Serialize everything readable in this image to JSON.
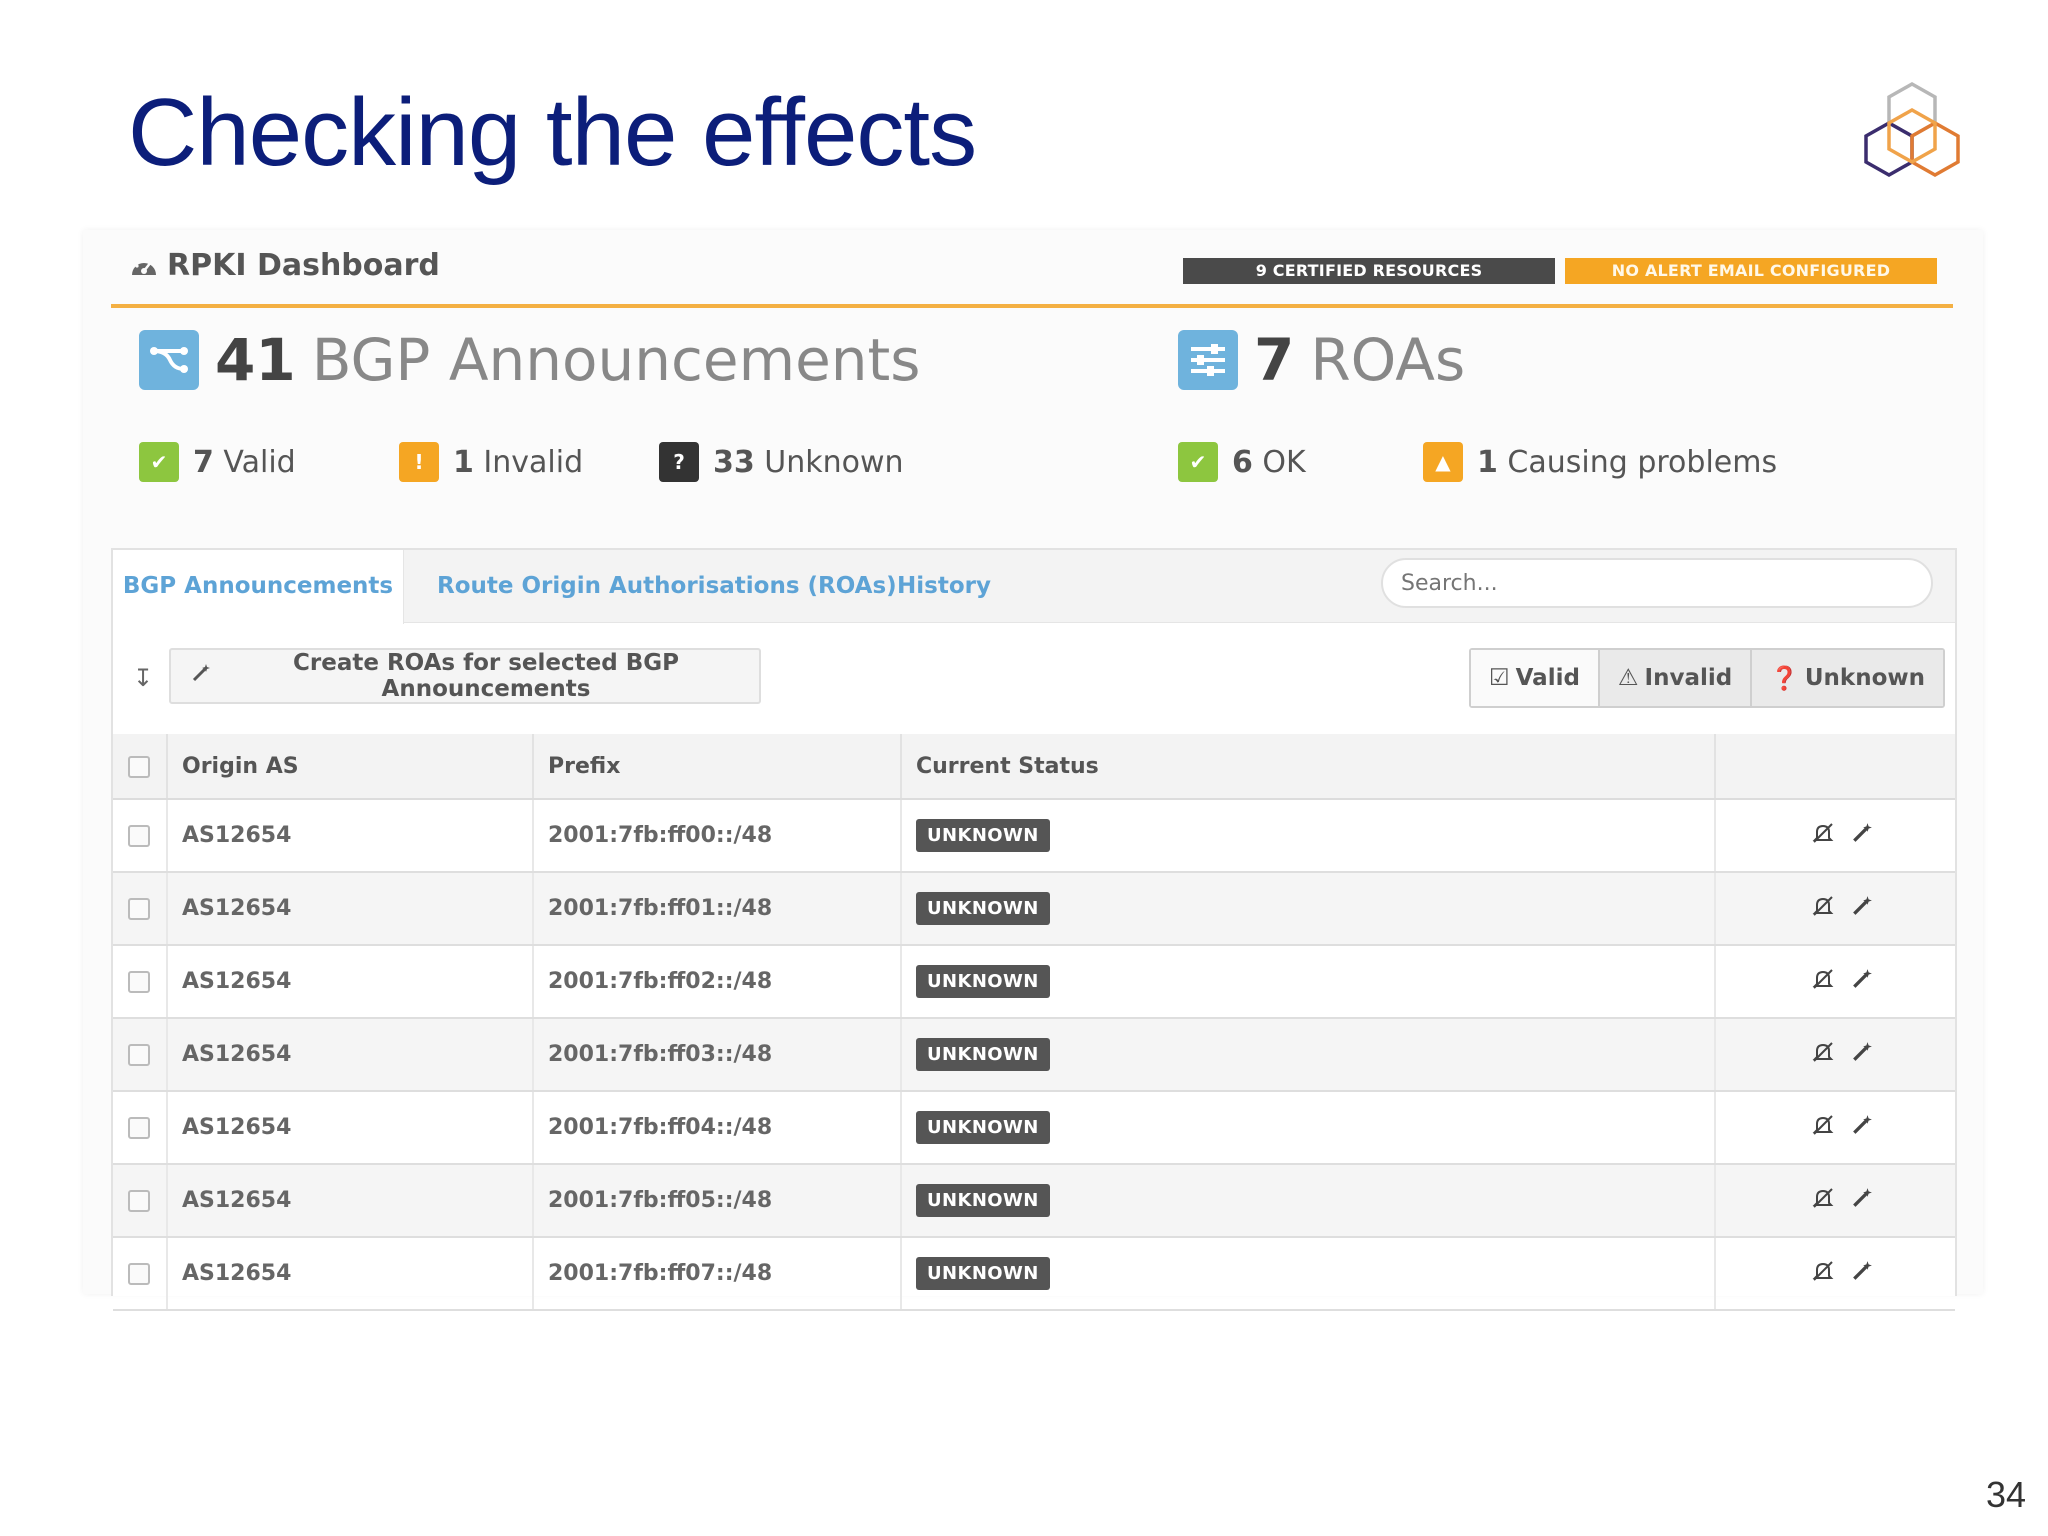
{
  "slide": {
    "title": "Checking the effects",
    "page_number": "34"
  },
  "dashboard": {
    "title": "RPKI Dashboard",
    "badges": {
      "certified": "9 CERTIFIED RESOURCES",
      "alert": "NO ALERT EMAIL CONFIGURED"
    },
    "bgp": {
      "count": "41",
      "label": "BGP Announcements"
    },
    "roas": {
      "count": "7",
      "label": "ROAs"
    },
    "bgp_breakdown": [
      {
        "num": "7",
        "label": "Valid"
      },
      {
        "num": "1",
        "label": "Invalid"
      },
      {
        "num": "33",
        "label": "Unknown"
      }
    ],
    "roa_breakdown": [
      {
        "num": "6",
        "label": "OK"
      },
      {
        "num": "1",
        "label": "Causing problems"
      }
    ],
    "tabs": [
      {
        "label": "BGP Announcements"
      },
      {
        "label": "Route Origin Authorisations (ROAs)"
      },
      {
        "label": "History"
      }
    ],
    "search": {
      "placeholder": "Search..."
    },
    "create_button": "Create ROAs for selected BGP Announcements",
    "filters": [
      {
        "label": "Valid"
      },
      {
        "label": "Invalid"
      },
      {
        "label": "Unknown"
      }
    ],
    "columns": [
      "Origin AS",
      "Prefix",
      "Current Status"
    ],
    "rows": [
      {
        "origin": "AS12654",
        "prefix": "2001:7fb:ff00::/48",
        "status": "UNKNOWN"
      },
      {
        "origin": "AS12654",
        "prefix": "2001:7fb:ff01::/48",
        "status": "UNKNOWN"
      },
      {
        "origin": "AS12654",
        "prefix": "2001:7fb:ff02::/48",
        "status": "UNKNOWN"
      },
      {
        "origin": "AS12654",
        "prefix": "2001:7fb:ff03::/48",
        "status": "UNKNOWN"
      },
      {
        "origin": "AS12654",
        "prefix": "2001:7fb:ff04::/48",
        "status": "UNKNOWN"
      },
      {
        "origin": "AS12654",
        "prefix": "2001:7fb:ff05::/48",
        "status": "UNKNOWN"
      },
      {
        "origin": "AS12654",
        "prefix": "2001:7fb:ff07::/48",
        "status": "UNKNOWN"
      }
    ]
  },
  "colors": {
    "title": "#0c1e7a",
    "accent_orange": "#f5a623",
    "ok_green": "#8dc63f",
    "link_blue": "#5da3d6",
    "icon_blue": "#6fb3dd"
  },
  "icons": {
    "dashboard": "gauge-icon",
    "bgp": "route-branch-icon",
    "roas": "sliders-icon",
    "valid": "check-square-icon",
    "invalid": "exclamation-icon",
    "unknown": "question-icon",
    "row_mute": "bell-slash-icon",
    "row_create": "magic-wand-icon"
  }
}
